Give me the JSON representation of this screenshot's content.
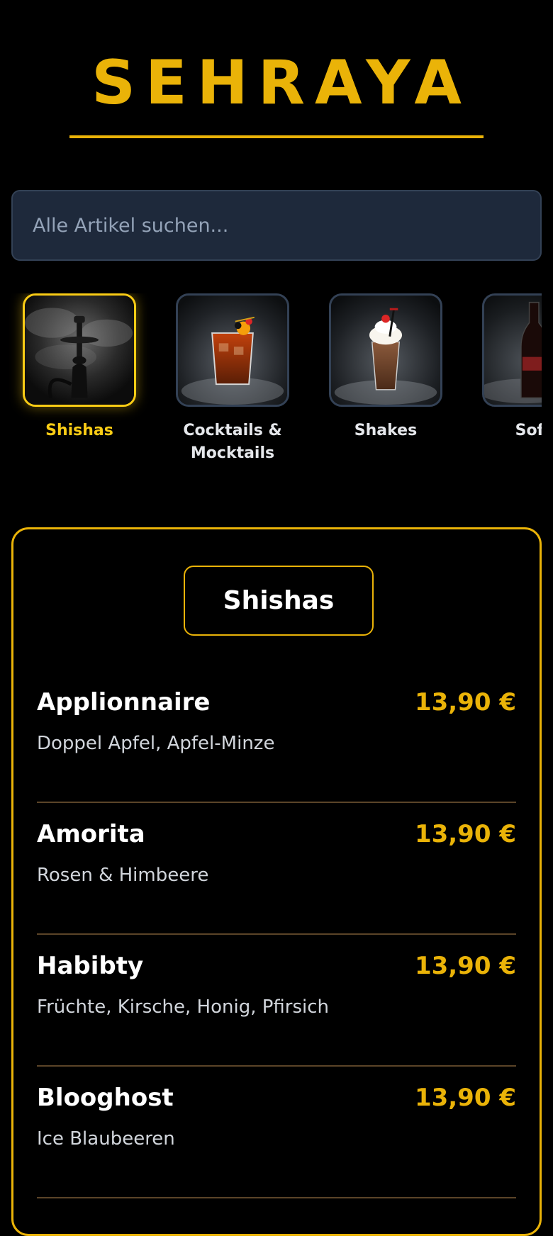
{
  "brand": {
    "title": "SEHRAYA"
  },
  "search": {
    "placeholder": "Alle Artikel suchen..."
  },
  "colors": {
    "accent": "#eab308",
    "background": "#000000",
    "search_bg": "#1e293b"
  },
  "categories": [
    {
      "label": "Shishas",
      "icon": "hookah-image",
      "active": true
    },
    {
      "label": "Cocktails &\nMocktails",
      "icon": "cocktail-image",
      "active": false
    },
    {
      "label": "Shakes",
      "icon": "milkshake-image",
      "active": false
    },
    {
      "label": "Softd",
      "icon": "soft-drink-bottle-image",
      "active": false
    }
  ],
  "menu": {
    "section_title": "Shishas",
    "items": [
      {
        "name": "Applionnaire",
        "description": "Doppel Apfel, Apfel-Minze",
        "price": "13,90 €"
      },
      {
        "name": "Amorita",
        "description": "Rosen & Himbeere",
        "price": "13,90 €"
      },
      {
        "name": "Habibty",
        "description": "Früchte, Kirsche, Honig, Pfirsich",
        "price": "13,90 €"
      },
      {
        "name": "Blooghost",
        "description": "Ice Blaubeeren",
        "price": "13,90 €"
      }
    ]
  }
}
